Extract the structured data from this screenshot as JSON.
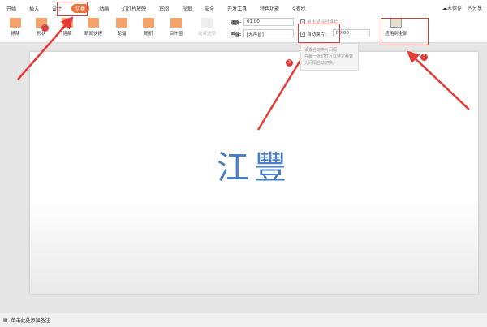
{
  "menu": [
    "开始",
    "插入",
    "设计",
    "切换",
    "动画",
    "幻灯片放映",
    "审阅",
    "视图",
    "安全",
    "开发工具",
    "特色功能",
    "查找"
  ],
  "right": {
    "save": "未保存",
    "share": "分享"
  },
  "effects": [
    "擦除",
    "形状",
    "溶解",
    "新闻快报",
    "轮辐",
    "随机",
    "百叶窗"
  ],
  "effect_options": "效果选项",
  "speed": {
    "label": "速度:",
    "value": "01.00"
  },
  "sound": {
    "label": "声音:",
    "value": "[无声音]"
  },
  "click_advance": "单击鼠标时换片",
  "auto_advance": {
    "label": "自动换片:",
    "value": "00:00"
  },
  "apply_all": "应用到全部",
  "tooltip": {
    "title": "设置自动换片间隔",
    "body": "在每一张幻灯片以特定秒数为间隔自动切换。"
  },
  "slide_title": "江豐",
  "notes": "单击此处添加备注",
  "badges": [
    "1",
    "2",
    "3"
  ],
  "accent": "#e8743b"
}
